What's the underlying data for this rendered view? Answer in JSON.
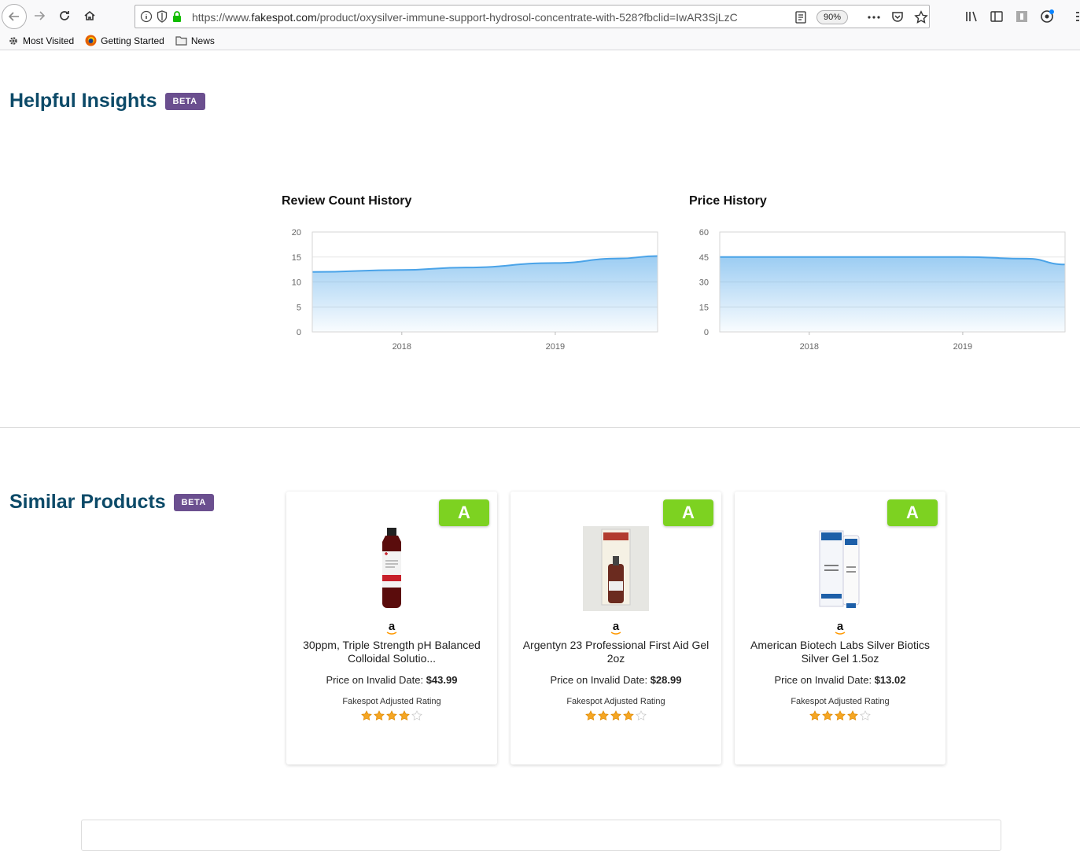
{
  "browser": {
    "url_scheme": "https://www.",
    "url_domain": "fakespot.com",
    "url_path": "/product/oxysilver-immune-support-hydrosol-concentrate-with-528?fbclid=IwAR3SjLzC",
    "zoom": "90%",
    "bookmarks": [
      {
        "label": "Most Visited",
        "icon": "gear-icon"
      },
      {
        "label": "Getting Started",
        "icon": "firefox-icon"
      },
      {
        "label": "News",
        "icon": "folder-icon"
      }
    ]
  },
  "insights": {
    "title": "Helpful Insights",
    "badge": "BETA"
  },
  "chart_data": [
    {
      "type": "area",
      "title": "Review Count History",
      "x": [
        "2017-06",
        "2018-01",
        "2018-06",
        "2019-01",
        "2019-06",
        "2019-09"
      ],
      "xticks": [
        "2018",
        "2019"
      ],
      "values": [
        12,
        12.4,
        12.9,
        13.8,
        14.7,
        15.2
      ],
      "yticks": [
        0,
        5,
        10,
        15,
        20
      ],
      "ylim": [
        0,
        20
      ],
      "grid": true,
      "color": "#4aa3e8"
    },
    {
      "type": "area",
      "title": "Price History",
      "x": [
        "2017-06",
        "2018-01",
        "2018-06",
        "2019-01",
        "2019-06",
        "2019-09"
      ],
      "xticks": [
        "2018",
        "2019"
      ],
      "values": [
        45,
        45,
        45,
        45,
        44,
        40.5
      ],
      "yticks": [
        0,
        15,
        30,
        45,
        60
      ],
      "ylim": [
        0,
        60
      ],
      "grid": true,
      "color": "#4aa3e8"
    }
  ],
  "similar": {
    "title": "Similar Products",
    "badge": "BETA",
    "products": [
      {
        "grade": "A",
        "store": "a",
        "name": "30ppm, Triple Strength pH Balanced Colloidal Solutio...",
        "price_label": "Price on Invalid Date: ",
        "price": "$43.99",
        "rating_label": "Fakespot Adjusted Rating",
        "rating": 4
      },
      {
        "grade": "A",
        "store": "a",
        "name": "Argentyn 23 Professional First Aid Gel 2oz",
        "price_label": "Price on Invalid Date: ",
        "price": "$28.99",
        "rating_label": "Fakespot Adjusted Rating",
        "rating": 4
      },
      {
        "grade": "A",
        "store": "a",
        "name": "American Biotech Labs Silver Biotics Silver Gel 1.5oz",
        "price_label": "Price on Invalid Date: ",
        "price": "$13.02",
        "rating_label": "Fakespot Adjusted Rating",
        "rating": 4
      }
    ]
  }
}
